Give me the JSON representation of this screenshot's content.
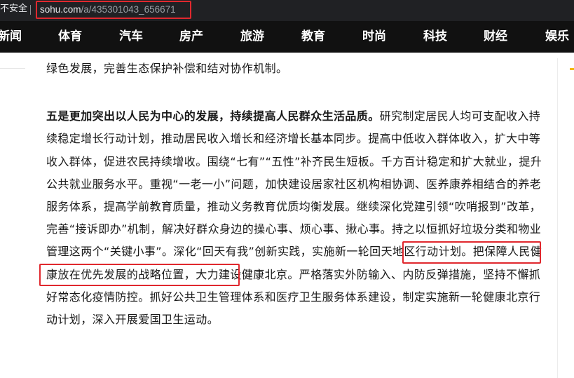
{
  "browser": {
    "security_label": "不安全",
    "url_domain": "sohu.com",
    "url_path": "/a/435301043_656671"
  },
  "nav": {
    "items": [
      "新闻",
      "体育",
      "汽车",
      "房产",
      "旅游",
      "教育",
      "时尚",
      "科技",
      "财经",
      "娱乐"
    ]
  },
  "article": {
    "para_top": "绿色发展，完善生态保护补偿和结对协作机制。",
    "para_main": {
      "lead": "五是更加突出以人民为中心的发展，持续提高人民群众生活品质。",
      "text_1": "研究制定居民人均可支配收入持续稳定增长行动计划，推动居民收入增长和经济增长基本同步。提高中低收入群体收入，扩大中等收入群体，促进农民持续增收。围绕“七有”“五性”补齐民生短板。千方百计稳定和扩大就业，提升公共就业服务水平。重视“一老一小”问题，加快建设居家社区机构相协调、医养康养相结合的养老服务体系，提高学前教育质量，推动义务教育优质均衡发展。继续深化党建引领“吹哨报到”改革，完善“接诉即办”机制，解决好群众身边的操心事、烦心事、揪心事。持之以恒抓好垃圾分类和物业管理这两个“关键小事”",
      "text_2": "。深化“回天有我”创新实践，实施新一轮回天地区行动计划。",
      "text_3": "把保障人民健康放在优先发展的战略位置，大力建设健康北京。严格落实外防输入、内防反弹措施，坚持不懈抓好常态化疫情防控。抓好公共卫生管理体系和医疗卫生服务体系建设，制定实施新一轮健康北京行动计划，深入开展爱国卫生运动。"
    }
  },
  "colors": {
    "highlight_border": "#e0282e",
    "nav_background": "#111111",
    "address_bar_background": "#202124",
    "accent": "#f5b600"
  }
}
